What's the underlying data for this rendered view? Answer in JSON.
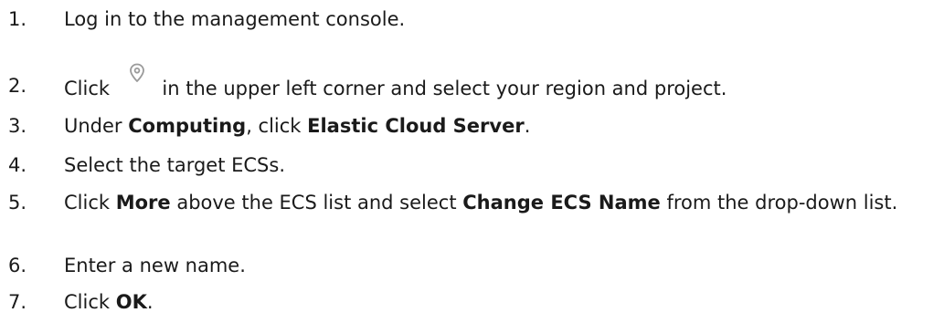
{
  "steps": [
    {
      "num": "1.",
      "parts": [
        {
          "t": "Log in to the management console.",
          "b": false
        }
      ]
    },
    {
      "num": "2.",
      "parts": [
        {
          "t": "Click ",
          "b": false
        },
        {
          "icon": "location-pin-icon"
        },
        {
          "t": " in the upper left corner and select your region and project.",
          "b": false
        }
      ]
    },
    {
      "num": "3.",
      "parts": [
        {
          "t": "Under ",
          "b": false
        },
        {
          "t": "Computing",
          "b": true
        },
        {
          "t": ", click ",
          "b": false
        },
        {
          "t": "Elastic Cloud Server",
          "b": true
        },
        {
          "t": ".",
          "b": false
        }
      ]
    },
    {
      "num": "4.",
      "parts": [
        {
          "t": "Select the target ECSs.",
          "b": false
        }
      ]
    },
    {
      "num": "5.",
      "parts": [
        {
          "t": "Click ",
          "b": false
        },
        {
          "t": "More",
          "b": true
        },
        {
          "t": " above the ECS list and select ",
          "b": false
        },
        {
          "t": "Change ECS Name",
          "b": true
        },
        {
          "t": " from the drop-down list.",
          "b": false
        }
      ]
    },
    {
      "num": "6.",
      "parts": [
        {
          "t": "Enter a new name.",
          "b": false
        }
      ]
    },
    {
      "num": "7.",
      "parts": [
        {
          "t": "Click ",
          "b": false
        },
        {
          "t": "OK",
          "b": true
        },
        {
          "t": ".",
          "b": false
        }
      ]
    }
  ],
  "icon_color": "#9a9a9a"
}
